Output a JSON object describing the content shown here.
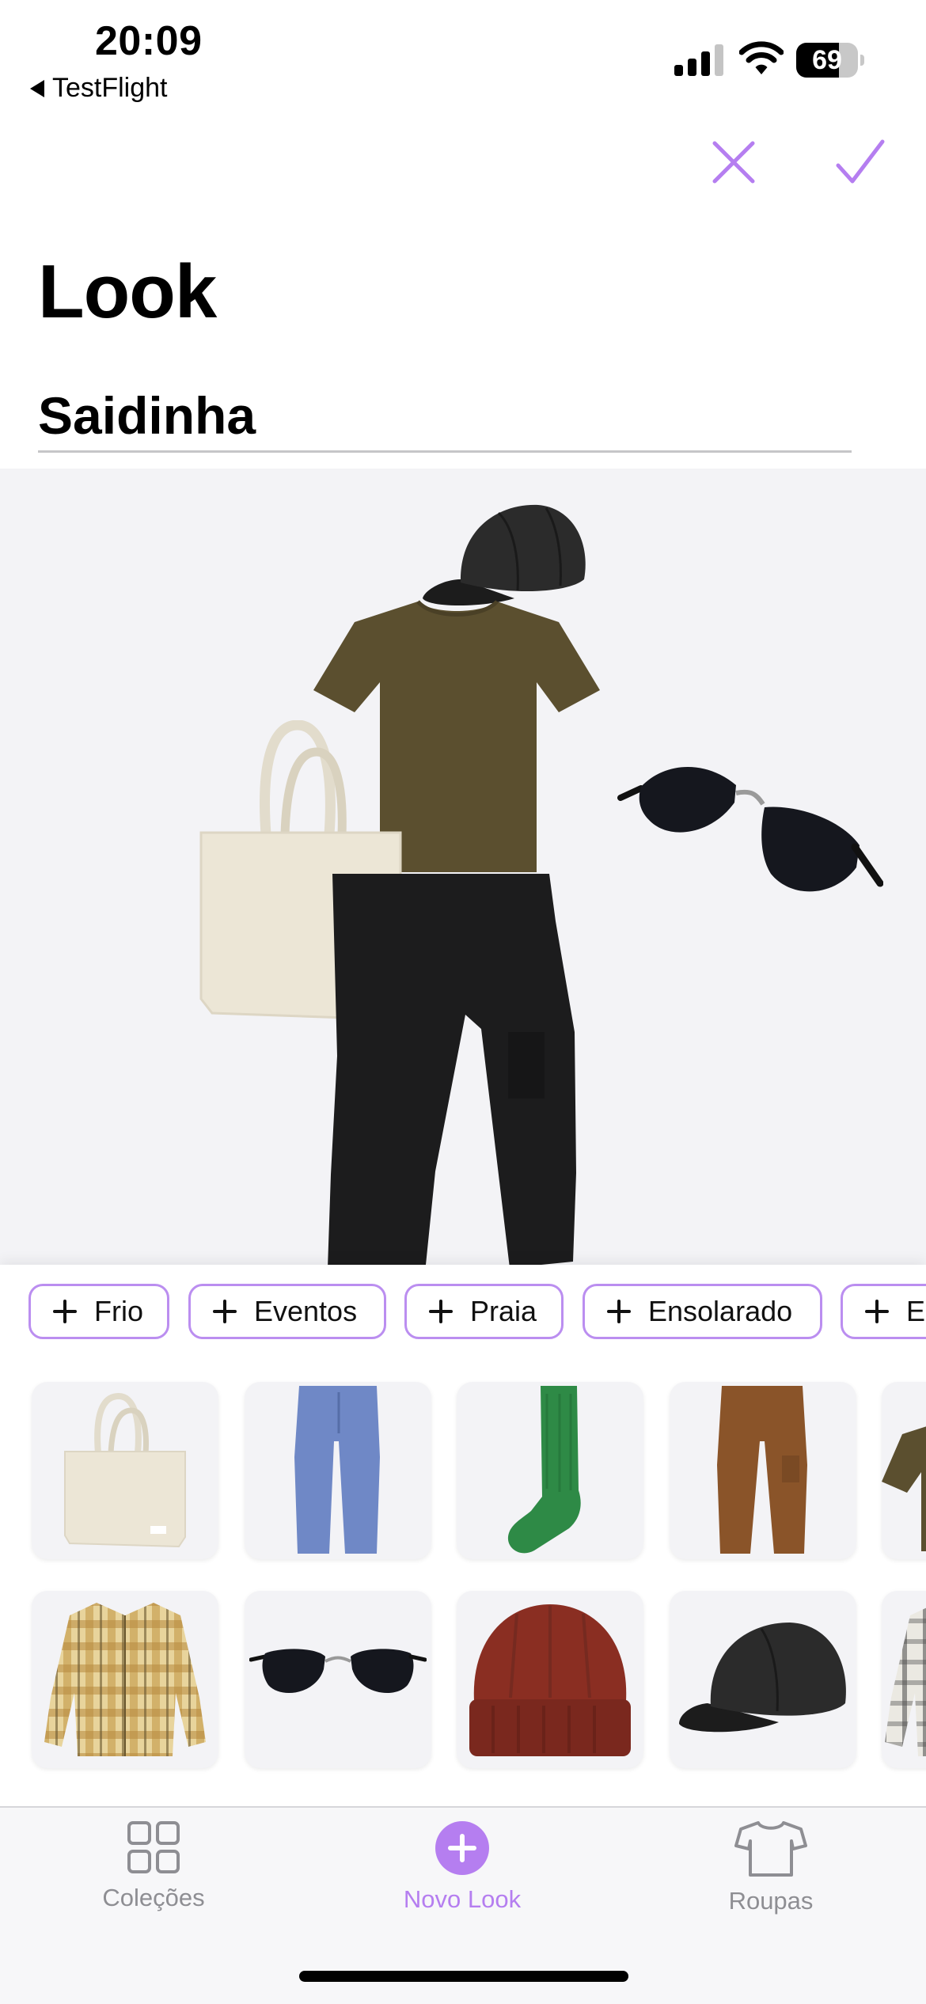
{
  "status_bar": {
    "time": "20:09",
    "back_app": "TestFlight",
    "battery_percent": "69",
    "battery_level": 0.69,
    "signal_bars_active": 3
  },
  "nav": {
    "close_icon": "xmark-icon",
    "confirm_icon": "checkmark-icon",
    "accent_color": "#b57ef0"
  },
  "header": {
    "title": "Look",
    "look_name": "Saidinha"
  },
  "canvas": {
    "items": [
      "cap-icon",
      "tshirt-icon",
      "tote-bag-icon",
      "sunglasses-icon",
      "pants-icon"
    ]
  },
  "tags": [
    {
      "label": "Frio"
    },
    {
      "label": "Eventos"
    },
    {
      "label": "Praia"
    },
    {
      "label": "Ensolarado"
    },
    {
      "label": "E"
    }
  ],
  "wardrobe": {
    "row1": [
      "tote-bag-icon",
      "jeans-icon",
      "sock-icon",
      "cargo-pants-icon",
      "tshirt-icon"
    ],
    "row2": [
      "plaid-shirt-icon",
      "sunglasses-icon",
      "beanie-icon",
      "cap-icon",
      "plaid-shirt-icon"
    ]
  },
  "tab_bar": {
    "tabs": [
      {
        "label": "Coleções",
        "icon": "grid-icon",
        "active": false
      },
      {
        "label": "Novo Look",
        "icon": "plus-circle-icon",
        "active": true
      },
      {
        "label": "Roupas",
        "icon": "tshirt-outline-icon",
        "active": false
      }
    ]
  }
}
